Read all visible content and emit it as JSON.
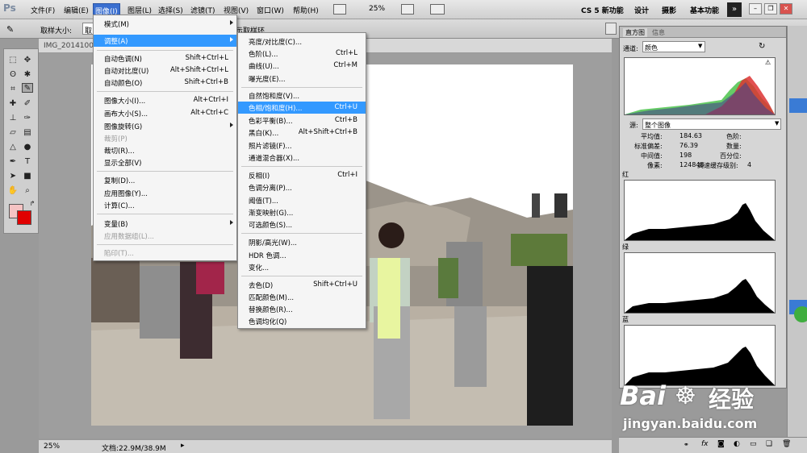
{
  "app_logo": "Ps",
  "menubar": {
    "items": [
      "文件(F)",
      "编辑(E)",
      "图像(I)",
      "图层(L)",
      "选择(S)",
      "滤镜(T)",
      "视图(V)",
      "窗口(W)",
      "帮助(H)"
    ],
    "zoom": "25%",
    "workspaces": [
      "CS 5 新功能",
      "设计",
      "摄影",
      "基本功能"
    ],
    "more": "»"
  },
  "optbar": {
    "sample_label": "取样大小:",
    "sample_value": "取",
    "sample_ring": "示取样环"
  },
  "document": {
    "tab_title": "IMG_20141004",
    "status_zoom": "25%",
    "status_doc": "文档:22.9M/38.9M"
  },
  "image_menu": {
    "items": [
      {
        "label": "模式(M)",
        "shortcut": "",
        "submenu": true
      },
      {
        "label": "调整(A)",
        "shortcut": "",
        "submenu": true,
        "highlight": true
      },
      {
        "label": "自动色调(N)",
        "shortcut": "Shift+Ctrl+L"
      },
      {
        "label": "自动对比度(U)",
        "shortcut": "Alt+Shift+Ctrl+L"
      },
      {
        "label": "自动颜色(O)",
        "shortcut": "Shift+Ctrl+B"
      },
      {
        "label": "图像大小(I)...",
        "shortcut": "Alt+Ctrl+I"
      },
      {
        "label": "画布大小(S)...",
        "shortcut": "Alt+Ctrl+C"
      },
      {
        "label": "图像旋转(G)",
        "shortcut": "",
        "submenu": true
      },
      {
        "label": "裁剪(P)",
        "shortcut": "",
        "disabled": true
      },
      {
        "label": "裁切(R)...",
        "shortcut": ""
      },
      {
        "label": "显示全部(V)",
        "shortcut": ""
      },
      {
        "label": "复制(D)...",
        "shortcut": ""
      },
      {
        "label": "应用图像(Y)...",
        "shortcut": ""
      },
      {
        "label": "计算(C)...",
        "shortcut": ""
      },
      {
        "label": "变量(B)",
        "shortcut": "",
        "submenu": true
      },
      {
        "label": "应用数据组(L)...",
        "shortcut": "",
        "disabled": true
      },
      {
        "label": "陷印(T)...",
        "shortcut": "",
        "disabled": true
      }
    ]
  },
  "adjust_menu": {
    "items": [
      {
        "label": "亮度/对比度(C)...",
        "shortcut": ""
      },
      {
        "label": "色阶(L)...",
        "shortcut": "Ctrl+L"
      },
      {
        "label": "曲线(U)...",
        "shortcut": "Ctrl+M"
      },
      {
        "label": "曝光度(E)...",
        "shortcut": ""
      },
      {
        "label": "自然饱和度(V)...",
        "shortcut": ""
      },
      {
        "label": "色相/饱和度(H)...",
        "shortcut": "Ctrl+U",
        "highlight": true
      },
      {
        "label": "色彩平衡(B)...",
        "shortcut": "Ctrl+B"
      },
      {
        "label": "黑白(K)...",
        "shortcut": "Alt+Shift+Ctrl+B"
      },
      {
        "label": "照片滤镜(F)...",
        "shortcut": ""
      },
      {
        "label": "通道混合器(X)...",
        "shortcut": ""
      },
      {
        "label": "反相(I)",
        "shortcut": "Ctrl+I"
      },
      {
        "label": "色调分离(P)...",
        "shortcut": ""
      },
      {
        "label": "阈值(T)...",
        "shortcut": ""
      },
      {
        "label": "渐变映射(G)...",
        "shortcut": ""
      },
      {
        "label": "可选颜色(S)...",
        "shortcut": ""
      },
      {
        "label": "阴影/高光(W)...",
        "shortcut": ""
      },
      {
        "label": "HDR 色调...",
        "shortcut": ""
      },
      {
        "label": "变化...",
        "shortcut": ""
      },
      {
        "label": "去色(D)",
        "shortcut": "Shift+Ctrl+U"
      },
      {
        "label": "匹配颜色(M)...",
        "shortcut": ""
      },
      {
        "label": "替换颜色(R)...",
        "shortcut": ""
      },
      {
        "label": "色调均化(Q)",
        "shortcut": ""
      }
    ]
  },
  "histogram": {
    "tabs": [
      "直方图",
      "信息"
    ],
    "channel_label": "通道:",
    "channel_value": "颜色",
    "source_label": "源:",
    "source_value": "整个图像",
    "stats_left": [
      [
        "平均值:",
        "184.63"
      ],
      [
        "标准偏差:",
        "76.39"
      ],
      [
        "中间值:",
        "198"
      ],
      [
        "像素:",
        "124848"
      ]
    ],
    "stats_right": [
      [
        "色阶:",
        ""
      ],
      [
        "数量:",
        ""
      ],
      [
        "百分位:",
        ""
      ],
      [
        "高速缓存级别:",
        "4"
      ]
    ],
    "channels": [
      "红",
      "绿",
      "蓝"
    ]
  },
  "watermark": {
    "brand": "Bai",
    "brand2": "经验",
    "url": "jingyan.baidu.com"
  },
  "colors": {
    "fg": "#f5c3c3",
    "bg": "#e00000",
    "highlight": "#3399ff",
    "menu_active": "#3a6fd0"
  }
}
